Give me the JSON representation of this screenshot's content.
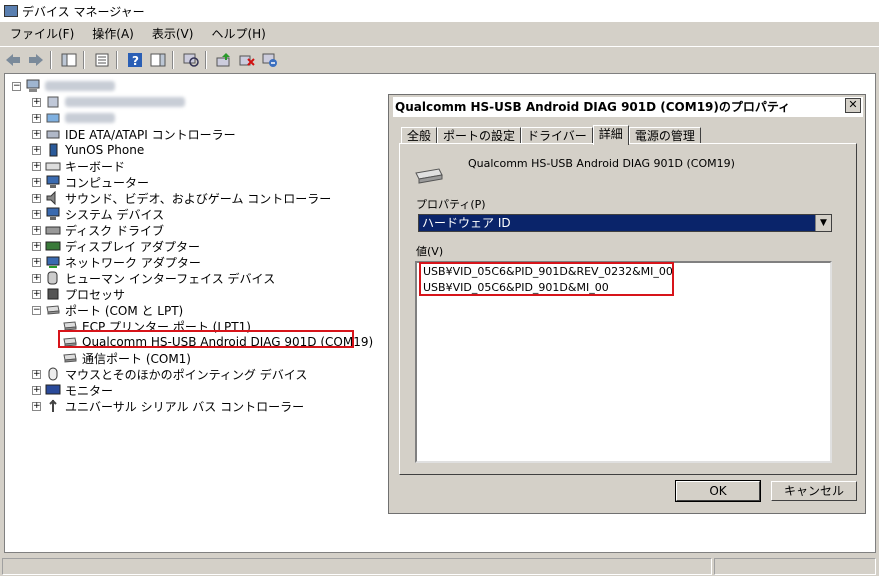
{
  "window": {
    "title": "デバイス マネージャー"
  },
  "menu": {
    "items": [
      "ファイル(F)",
      "操作(A)",
      "表示(V)",
      "ヘルプ(H)"
    ]
  },
  "tree": {
    "items": [
      {
        "label": "IDE ATA/ATAPI コントローラー"
      },
      {
        "label": "YunOS Phone"
      },
      {
        "label": "キーボード"
      },
      {
        "label": "コンピューター"
      },
      {
        "label": "サウンド、ビデオ、およびゲーム コントローラー"
      },
      {
        "label": "システム デバイス"
      },
      {
        "label": "ディスク ドライブ"
      },
      {
        "label": "ディスプレイ アダプター"
      },
      {
        "label": "ネットワーク アダプター"
      },
      {
        "label": "ヒューマン インターフェイス デバイス"
      },
      {
        "label": "プロセッサ"
      },
      {
        "label": "ポート (COM と LPT)"
      },
      {
        "label": "ECP プリンター ポート (LPT1)"
      },
      {
        "label": "Qualcomm HS-USB Android DIAG 901D (COM19)"
      },
      {
        "label": "通信ポート (COM1)"
      },
      {
        "label": "マウスとそのほかのポインティング デバイス"
      },
      {
        "label": "モニター"
      },
      {
        "label": "ユニバーサル シリアル バス コントローラー"
      }
    ]
  },
  "dialog": {
    "title": "Qualcomm HS-USB Android DIAG 901D (COM19)のプロパティ",
    "tabs": [
      "全般",
      "ポートの設定",
      "ドライバー",
      "詳細",
      "電源の管理"
    ],
    "device_name": "Qualcomm HS-USB Android DIAG 901D (COM19)",
    "property_label": "プロパティ(P)",
    "property_value": "ハードウェア ID",
    "value_label": "値(V)",
    "values": [
      "USB¥VID_05C6&PID_901D&REV_0232&MI_00",
      "USB¥VID_05C6&PID_901D&MI_00"
    ],
    "ok": "OK",
    "cancel": "キャンセル"
  },
  "colors": {
    "highlight_box": "#d7141a",
    "selected_bg": "#0a246a"
  }
}
